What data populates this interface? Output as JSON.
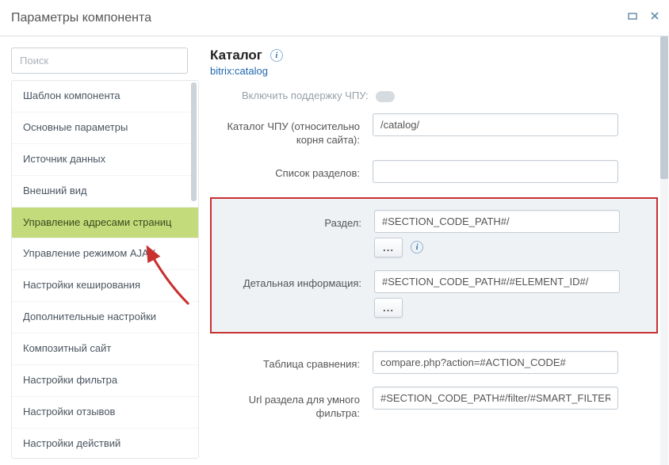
{
  "window": {
    "title": "Параметры компонента"
  },
  "search": {
    "placeholder": "Поиск"
  },
  "sidebar": {
    "items": [
      {
        "label": "Шаблон компонента",
        "active": false
      },
      {
        "label": "Основные параметры",
        "active": false
      },
      {
        "label": "Источник данных",
        "active": false
      },
      {
        "label": "Внешний вид",
        "active": false
      },
      {
        "label": "Управление адресами страниц",
        "active": true
      },
      {
        "label": "Управление режимом AJAX",
        "active": false
      },
      {
        "label": "Настройки кеширования",
        "active": false
      },
      {
        "label": "Дополнительные настройки",
        "active": false
      },
      {
        "label": "Композитный сайт",
        "active": false
      },
      {
        "label": "Настройки фильтра",
        "active": false
      },
      {
        "label": "Настройки отзывов",
        "active": false
      },
      {
        "label": "Настройки действий",
        "active": false
      }
    ]
  },
  "header": {
    "title": "Каталог",
    "component": "bitrix:catalog"
  },
  "truncated": {
    "label": "Включить поддержку ЧПУ:"
  },
  "rows": {
    "catalog_sef": {
      "label": "Каталог ЧПУ (относительно корня сайта):",
      "value": "/catalog/"
    },
    "sections_list": {
      "label": "Список разделов:",
      "value": ""
    },
    "section": {
      "label": "Раздел:",
      "value": "#SECTION_CODE_PATH#/"
    },
    "detail": {
      "label": "Детальная информация:",
      "value": "#SECTION_CODE_PATH#/#ELEMENT_ID#/"
    },
    "compare": {
      "label": "Таблица сравнения:",
      "value": "compare.php?action=#ACTION_CODE#"
    },
    "smart_filter": {
      "label": "Url раздела для умного фильтра:",
      "value": "#SECTION_CODE_PATH#/filter/#SMART_FILTER_PATH#/apply/"
    }
  },
  "buttons": {
    "dots": "..."
  }
}
